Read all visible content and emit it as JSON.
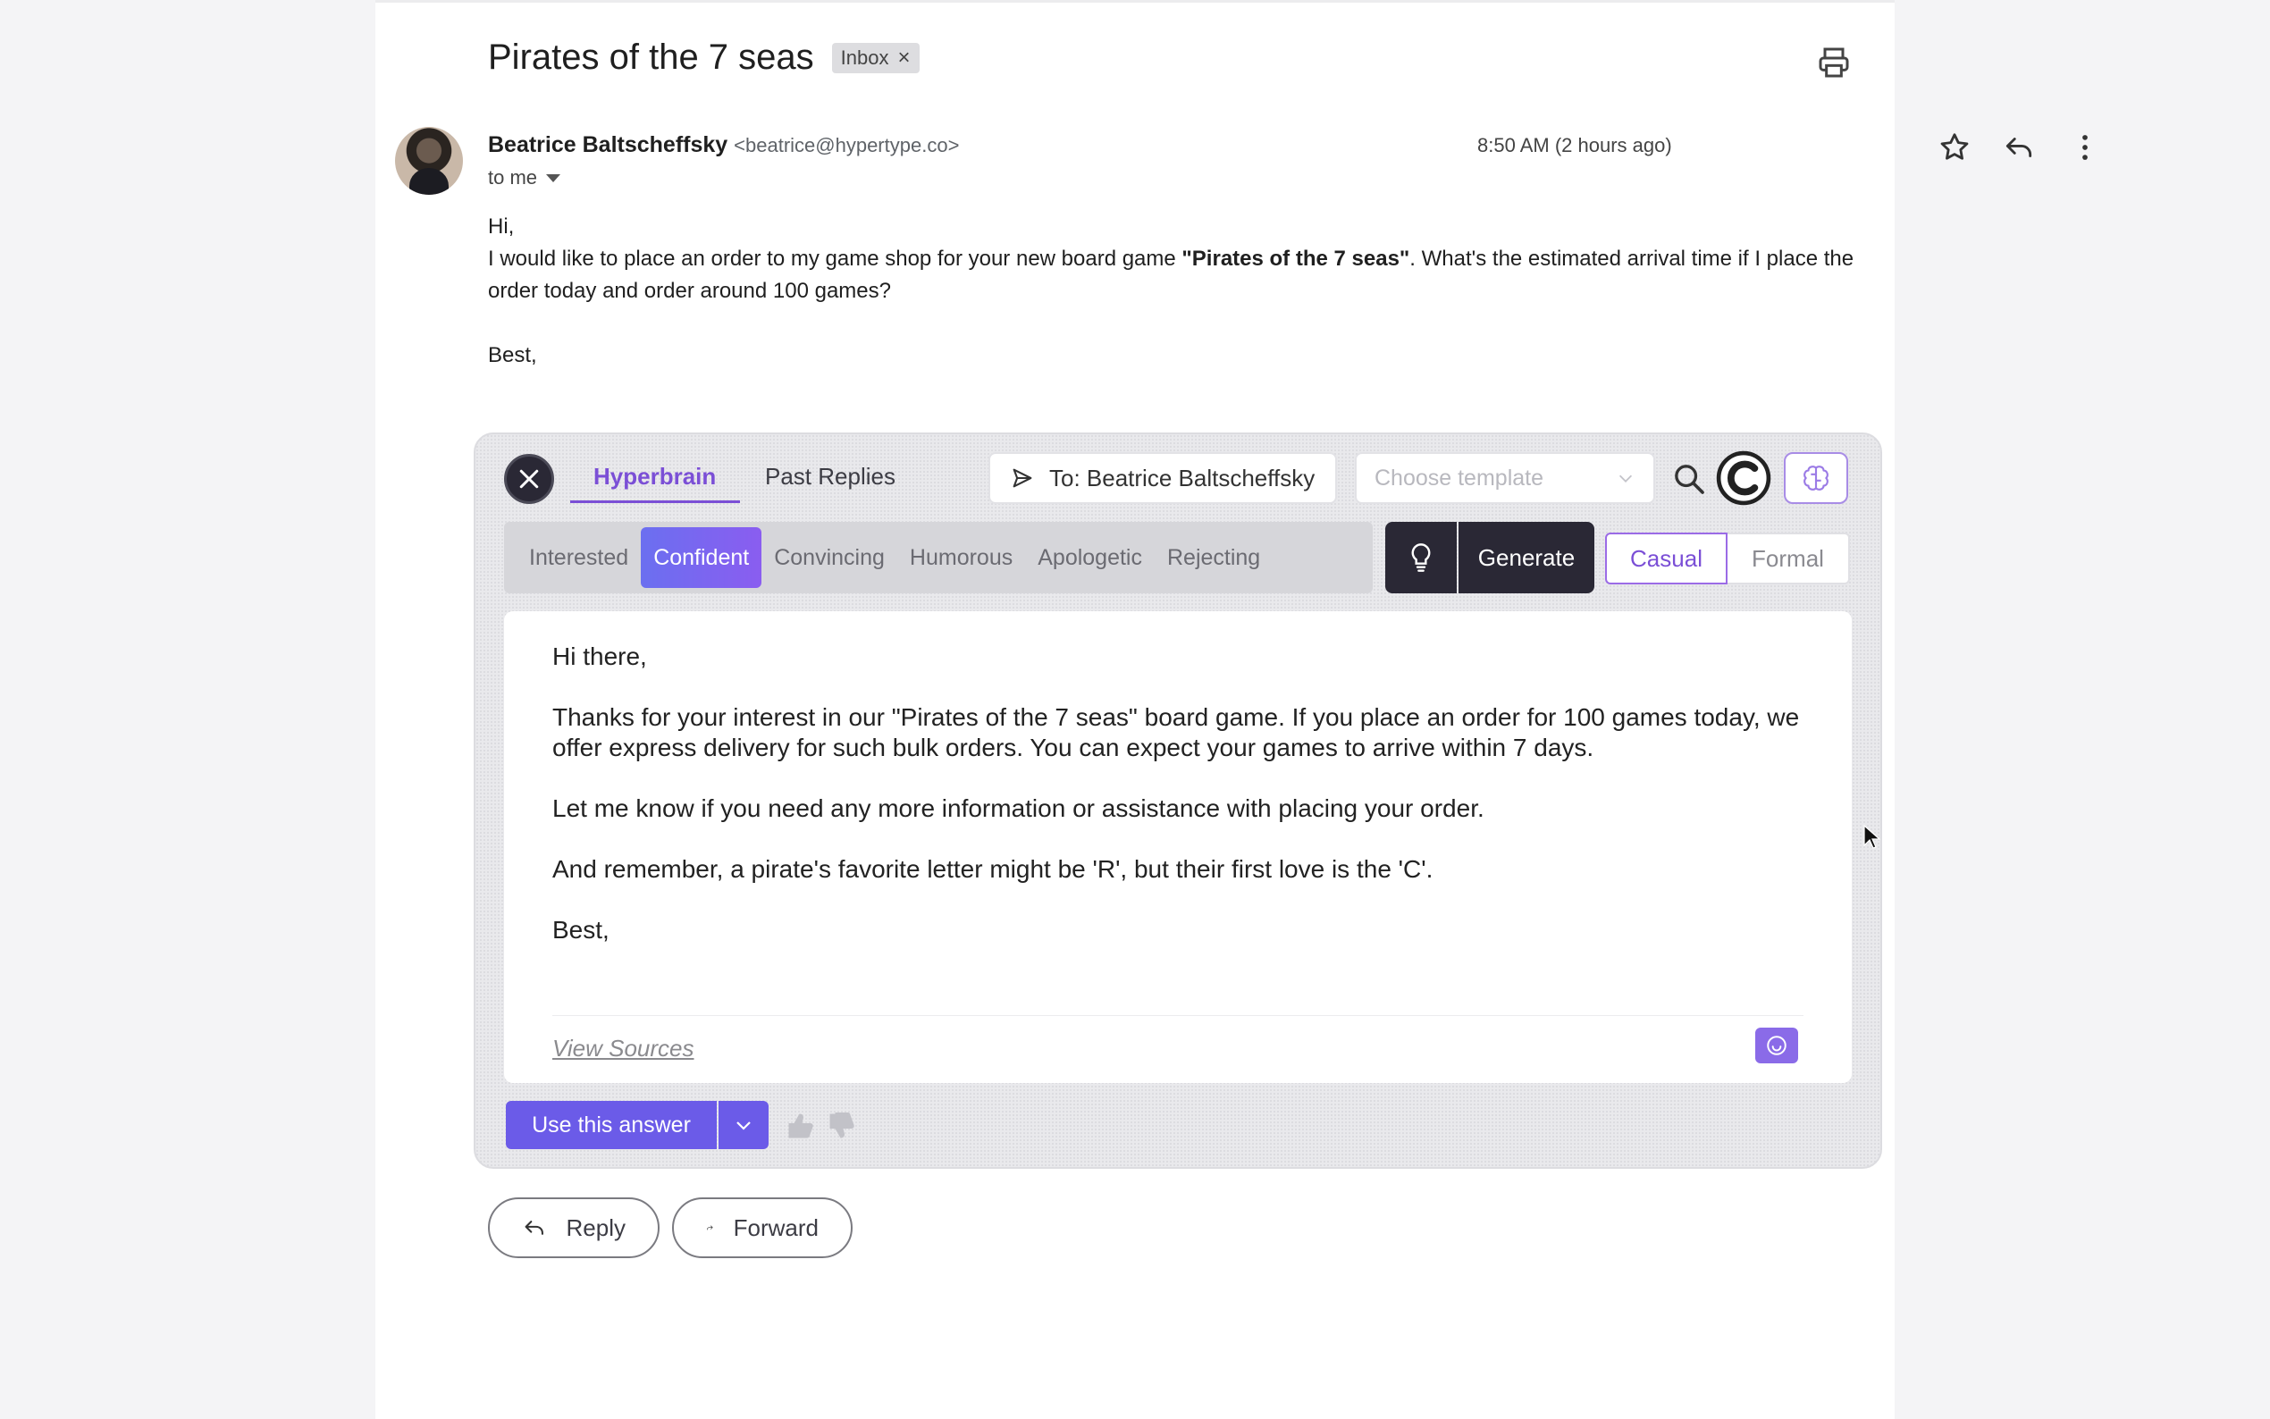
{
  "email": {
    "subject": "Pirates of the 7 seas",
    "label_chip": "Inbox",
    "sender_name": "Beatrice Baltscheffsky",
    "sender_email": "<beatrice@hypertype.co>",
    "recipient": "to me",
    "timestamp": "8:50 AM (2 hours ago)",
    "body": {
      "greeting": "Hi,",
      "line1_before": "I would like to place an order to my game shop for your new board game ",
      "line1_bold": "\"Pirates of the 7 seas\"",
      "line1_after": ". What's the estimated arrival time if I place the order today and order around 100 games?",
      "signoff": "Best,"
    }
  },
  "hyperbrain": {
    "tabs": [
      "Hyperbrain",
      "Past Replies"
    ],
    "to_label": "To: Beatrice Baltscheffsky",
    "template_placeholder": "Choose template",
    "tones": [
      "Interested",
      "Confident",
      "Convincing",
      "Humorous",
      "Apologetic",
      "Rejecting"
    ],
    "active_tone": "Confident",
    "generate_label": "Generate",
    "styles": [
      "Casual",
      "Formal"
    ],
    "selected_style": "Casual",
    "reply": {
      "greeting": "Hi there,",
      "p1": "Thanks for your interest in our \"Pirates of the 7 seas\" board game. If you place an order for 100 games today, we offer express delivery for such bulk orders. You can expect your games to arrive within 7 days.",
      "p2": "Let me know if you need any more information or assistance with placing your order.",
      "p3": "And remember, a pirate's favorite letter might be 'R', but their first love is the 'C'.",
      "signoff": "Best,"
    },
    "view_sources": "View Sources",
    "use_answer": "Use this answer"
  },
  "actions": {
    "reply": "Reply",
    "forward": "Forward"
  },
  "colors": {
    "accent_purple": "#7b4fd6",
    "button_purple": "#6b5be8",
    "dark": "#2a2835"
  }
}
